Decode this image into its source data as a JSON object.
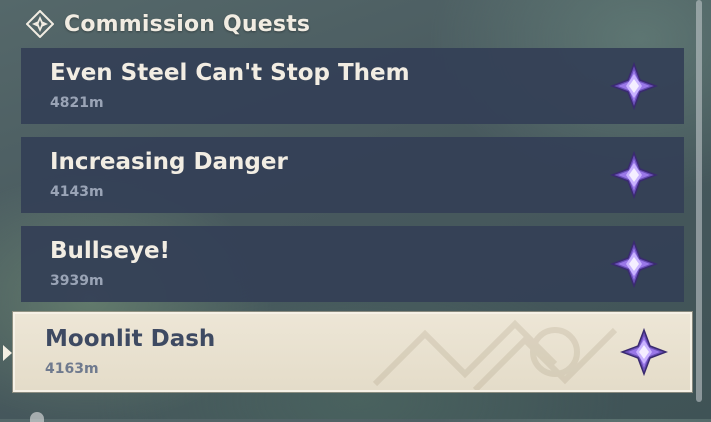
{
  "header": {
    "title": "Commission Quests",
    "icon": "commission-diamond-icon"
  },
  "quests": [
    {
      "name": "Even Steel Can't Stop Them",
      "distance": "4821m",
      "icon": "commission-star-icon",
      "selected": false
    },
    {
      "name": "Increasing Danger",
      "distance": "4143m",
      "icon": "commission-star-icon",
      "selected": false
    },
    {
      "name": "Bullseye!",
      "distance": "3939m",
      "icon": "commission-star-icon",
      "selected": false
    },
    {
      "name": "Moonlit Dash",
      "distance": "4163m",
      "icon": "commission-star-icon",
      "selected": true
    }
  ],
  "colors": {
    "card_bg": "#344056",
    "card_selected_bg": "#ede6d6",
    "icon_purple": "#9a78e8",
    "title_text": "#f1ece2"
  }
}
